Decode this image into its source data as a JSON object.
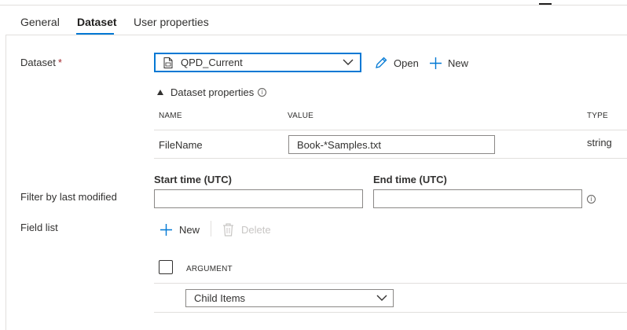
{
  "tabs": [
    {
      "label": "General",
      "active": false
    },
    {
      "label": "Dataset",
      "active": true
    },
    {
      "label": "User properties",
      "active": false
    }
  ],
  "dataset": {
    "label": "Dataset",
    "required_marker": "*",
    "selected": "QPD_Current",
    "open_label": "Open",
    "new_label": "New"
  },
  "dataset_properties": {
    "title": "Dataset properties",
    "info_glyph": "i",
    "columns": {
      "name": "NAME",
      "value": "VALUE",
      "type": "TYPE"
    },
    "rows": [
      {
        "name": "FileName",
        "value": "Book-*Samples.txt",
        "type": "string"
      }
    ]
  },
  "filter": {
    "label": "Filter by last modified",
    "start_label": "Start time (UTC)",
    "end_label": "End time (UTC)",
    "start_value": "",
    "end_value": "",
    "info_glyph": "i"
  },
  "field_list": {
    "label": "Field list",
    "new_label": "New",
    "delete_label": "Delete",
    "argument_header": "ARGUMENT",
    "argument_selected": "Child Items"
  },
  "colors": {
    "accent": "#0078d4",
    "disabled": "#c8c6c4",
    "required": "#a4262c"
  }
}
